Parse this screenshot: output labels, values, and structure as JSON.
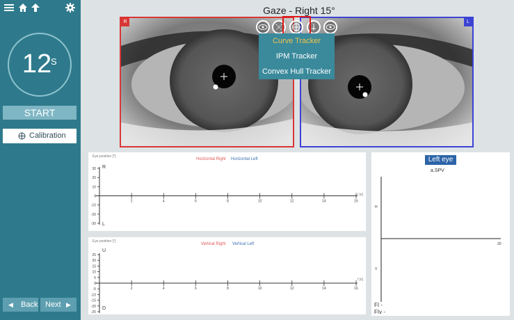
{
  "title": "Gaze - Right 15°",
  "sidebar": {
    "timer_value": "12",
    "timer_unit": "S",
    "start_label": "START",
    "calibration_label": "Calibration",
    "back_label": "Back",
    "next_label": "Next"
  },
  "eyes": {
    "right_badge": "R",
    "left_badge": "L"
  },
  "tracker_menu": {
    "items": [
      "Curve Tracker",
      "IPM Tracker",
      "Convex Hull Tracker"
    ],
    "selected": "Curve Tracker"
  },
  "horizontal_chart": {
    "axis_label": "Eye position [°]",
    "legend_right": "Horizontal Right",
    "legend_left": "Horizontal Left",
    "top_marker": "R",
    "bottom_marker": "L",
    "x_unit": "t [s]"
  },
  "vertical_chart": {
    "axis_label": "Eye position [°]",
    "legend_right": "Vertical Right",
    "legend_left": "Vertical Left",
    "top_marker": "U",
    "bottom_marker": "D",
    "x_unit": "t [s]"
  },
  "spv_panel": {
    "title": "Left eye",
    "subtitle": "a.SPV",
    "h_label": "H",
    "v_label": "V",
    "x_tick": "20",
    "fi_label": "FI -",
    "fiv_label": "FIv -"
  },
  "colors": {
    "sidebar": "#2e7a8c",
    "right_eye": "#d93636",
    "left_eye": "#3c43d4",
    "menu_active": "#f2c24a",
    "legend_right": "#e05555",
    "legend_left": "#3a6fb0"
  },
  "chart_data": [
    {
      "type": "line",
      "x_ticks": [
        2,
        4,
        6,
        8,
        10,
        12,
        14,
        16
      ],
      "y_ticks": [
        30,
        20,
        10,
        0,
        -10,
        -20,
        -30
      ],
      "xlim": [
        0,
        16
      ],
      "ylim": [
        -30,
        30
      ],
      "xlabel": "t [s]",
      "ylabel": "Eye position [°]",
      "series": [
        {
          "name": "Horizontal Right",
          "values": []
        },
        {
          "name": "Horizontal Left",
          "values": []
        }
      ]
    },
    {
      "type": "line",
      "x_ticks": [
        2,
        4,
        6,
        8,
        10,
        12,
        14,
        16
      ],
      "y_ticks": [
        25,
        20,
        15,
        10,
        5,
        0,
        -5,
        -10,
        -15,
        -20,
        -25
      ],
      "xlim": [
        0,
        16
      ],
      "ylim": [
        -25,
        25
      ],
      "xlabel": "t [s]",
      "ylabel": "Eye position [°]",
      "series": [
        {
          "name": "Vertical Right",
          "values": []
        },
        {
          "name": "Vertical Left",
          "values": []
        }
      ]
    }
  ]
}
